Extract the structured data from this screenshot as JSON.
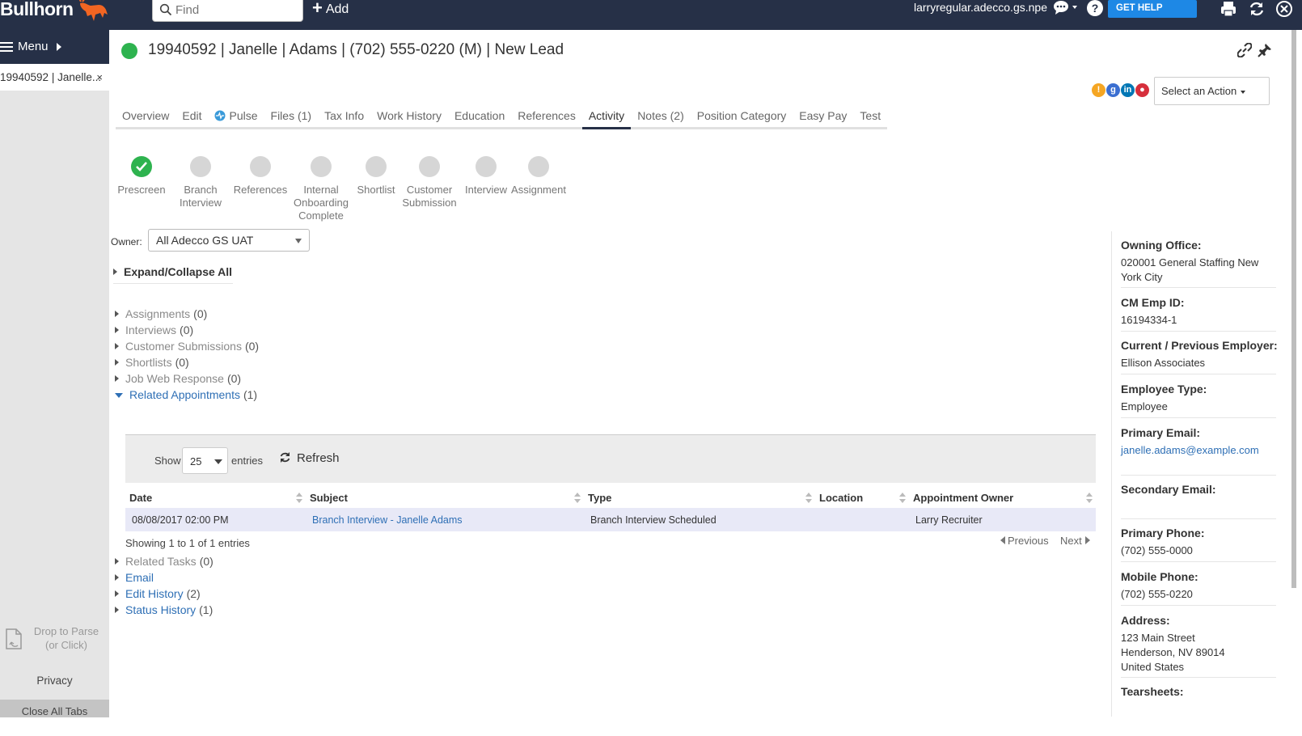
{
  "topbar": {
    "logo": "Bullhorn",
    "search_placeholder": "Find",
    "add_label": "Add",
    "user": "larryregular.adecco.gs.npe",
    "help_label": "GET HELP"
  },
  "leftnav": {
    "menu_label": "Menu",
    "open_tab": "19940592 | Janelle...",
    "open_tab_close": "×",
    "drop_to_parse": "Drop to Parse",
    "drop_or_click": "(or Click)",
    "privacy": "Privacy",
    "close_all_tabs": "Close All Tabs"
  },
  "header": {
    "title": "19940592 | Janelle | Adams | (702) 555-0220 (M) | New Lead",
    "status_color": "#2eb34f"
  },
  "actions": {
    "select_label": "Select an Action"
  },
  "tabs": [
    {
      "label": "Overview",
      "active": false
    },
    {
      "label": "Edit",
      "active": false
    },
    {
      "label": "Pulse",
      "active": false,
      "icon": "pulse-icon"
    },
    {
      "label": "Files (1)",
      "active": false
    },
    {
      "label": "Tax Info",
      "active": false
    },
    {
      "label": "Work History",
      "active": false
    },
    {
      "label": "Education",
      "active": false
    },
    {
      "label": "References",
      "active": false
    },
    {
      "label": "Activity",
      "active": true
    },
    {
      "label": "Notes (2)",
      "active": false
    },
    {
      "label": "Position Category",
      "active": false
    },
    {
      "label": "Easy Pay",
      "active": false
    },
    {
      "label": "Test",
      "active": false
    }
  ],
  "pipeline": [
    {
      "label": "Prescreen",
      "done": true
    },
    {
      "label": "Branch Interview",
      "done": false
    },
    {
      "label": "References",
      "done": false
    },
    {
      "label": "Internal Onboarding Complete",
      "done": false
    },
    {
      "label": "Shortlist",
      "done": false
    },
    {
      "label": "Customer Submission",
      "done": false
    },
    {
      "label": "Interview",
      "done": false
    },
    {
      "label": "Assignment",
      "done": false
    }
  ],
  "owner": {
    "label": "Owner:",
    "value": "All Adecco GS UAT"
  },
  "expand_label": "Expand/Collapse All",
  "sections": [
    {
      "label": "Assignments",
      "count": "(0)",
      "expanded": false,
      "link": false
    },
    {
      "label": "Interviews",
      "count": "(0)",
      "expanded": false,
      "link": false
    },
    {
      "label": "Customer Submissions",
      "count": "(0)",
      "expanded": false,
      "link": false
    },
    {
      "label": "Shortlists",
      "count": "(0)",
      "expanded": false,
      "link": false
    },
    {
      "label": "Job Web Response",
      "count": "(0)",
      "expanded": false,
      "link": false
    },
    {
      "label": "Related Appointments",
      "count": "(1)",
      "expanded": true,
      "link": true
    }
  ],
  "sections_after": [
    {
      "label": "Related Tasks",
      "count": "(0)",
      "link": false
    },
    {
      "label": "Email",
      "count": "",
      "link": true
    },
    {
      "label": "Edit History",
      "count": "(2)",
      "link": true
    },
    {
      "label": "Status History",
      "count": "(1)",
      "link": true
    }
  ],
  "appointments": {
    "show_label": "Show",
    "page_size": "25",
    "entries_label": "entries",
    "refresh_label": "Refresh",
    "columns": [
      "Date",
      "Subject",
      "Type",
      "Location",
      "Appointment Owner"
    ],
    "rows": [
      {
        "date": "08/08/2017 02:00 PM",
        "subject": "Branch Interview - Janelle Adams",
        "type": "Branch Interview Scheduled",
        "location": "",
        "owner": "Larry Recruiter"
      }
    ],
    "showing": "Showing 1 to 1 of 1 entries",
    "previous": "Previous",
    "next": "Next"
  },
  "sidebar": {
    "owning_office_label": "Owning Office:",
    "owning_office": "020001 General Staffing New York City",
    "cm_emp_id_label": "CM Emp ID:",
    "cm_emp_id": "16194334-1",
    "employer_label": "Current / Previous Employer:",
    "employer": "Ellison Associates",
    "employee_type_label": "Employee Type:",
    "employee_type": "Employee",
    "primary_email_label": "Primary Email:",
    "primary_email": "janelle.adams@example.com",
    "secondary_email_label": "Secondary Email:",
    "secondary_email": "",
    "primary_phone_label": "Primary Phone:",
    "primary_phone": "(702) 555-0000",
    "mobile_phone_label": "Mobile Phone:",
    "mobile_phone": "(702) 555-0220",
    "address_label": "Address:",
    "address_line1": "123 Main Street",
    "address_line2": "Henderson, NV 89014",
    "address_line3": "United States",
    "tearsheets_label": "Tearsheets:"
  }
}
